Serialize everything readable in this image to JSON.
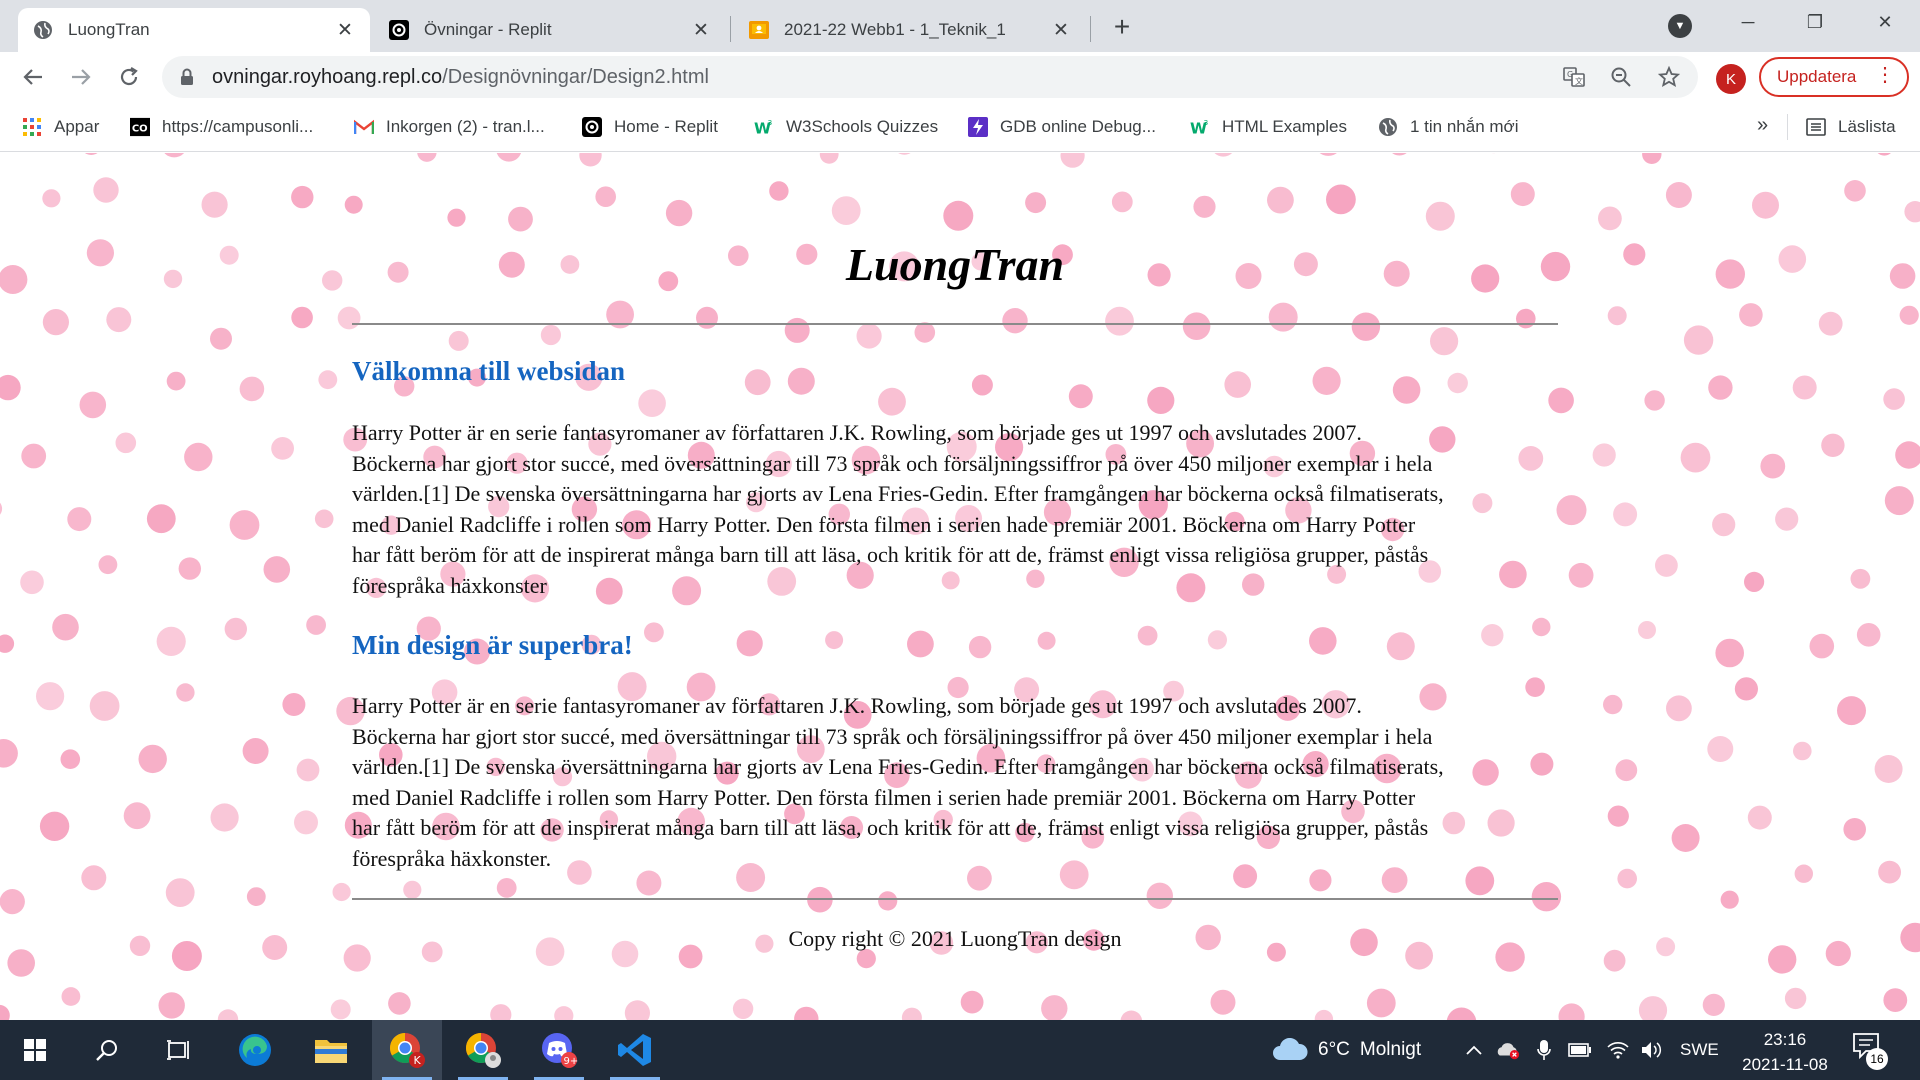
{
  "browser": {
    "tabs": [
      {
        "title": "LuongTran",
        "active": true,
        "icon": "globe-icon"
      },
      {
        "title": "Övningar - Replit",
        "active": false,
        "icon": "replit-icon"
      },
      {
        "title": "2021-22 Webb1 - 1_Teknik_1",
        "active": false,
        "icon": "classroom-icon"
      }
    ],
    "new_tab": "+",
    "window_controls": {
      "minimize": "─",
      "restore": "❐",
      "close": "✕"
    },
    "address": {
      "host": "ovningar.royhoang.repl.co",
      "path": "/Designövningar/Design2.html"
    },
    "profile_initial": "K",
    "update_label": "Uppdatera",
    "bookmarks": [
      {
        "label": "Appar",
        "icon": "apps-grid-icon"
      },
      {
        "label": "https://campusonli...",
        "icon": "campus-icon"
      },
      {
        "label": "Inkorgen (2) - tran.l...",
        "icon": "gmail-icon"
      },
      {
        "label": "Home - Replit",
        "icon": "replit-icon"
      },
      {
        "label": "W3Schools Quizzes",
        "icon": "w3schools-icon"
      },
      {
        "label": "GDB online Debug...",
        "icon": "gdb-icon"
      },
      {
        "label": "HTML Examples",
        "icon": "w3schools-icon"
      },
      {
        "label": "1 tin nhắn mới",
        "icon": "globe-icon"
      }
    ],
    "bookmarks_more": "»",
    "reading_list": "Läslista"
  },
  "page": {
    "site_title": "LuongTran",
    "sections": [
      {
        "heading": "Välkomna till websidan",
        "lines": [
          "Harry Potter är en serie fantasyromaner av författaren J.K. Rowling, som började ges ut 1997 och avslutades 2007.",
          "Böckerna har gjort stor succé, med översättningar till 73 språk och försäljningssiffror på över 450 miljoner exemplar i hela",
          "världen.[1] De svenska översättningarna har gjorts av Lena Fries-Gedin. Efter framgången har böckerna också filmatiserats,",
          "med Daniel Radcliffe i rollen som Harry Potter. Den första filmen i serien hade premiär 2001. Böckerna om Harry Potter",
          "har fått beröm för att de inspirerat många barn till att läsa, och kritik för att de, främst enligt vissa religiösa grupper, påstås",
          "förespråka häxkonster"
        ]
      },
      {
        "heading": "Min design är superbra!",
        "lines": [
          "Harry Potter är en serie fantasyromaner av författaren J.K. Rowling, som började ges ut 1997 och avslutades 2007.",
          "Böckerna har gjort stor succé, med översättningar till 73 språk och försäljningssiffror på över 450 miljoner exemplar i hela",
          "världen.[1] De svenska översättningarna har gjorts av Lena Fries-Gedin. Efter framgången har böckerna också filmatiserats,",
          "med Daniel Radcliffe i rollen som Harry Potter. Den första filmen i serien hade premiär 2001. Böckerna om Harry Potter",
          "har fått beröm för att de inspirerat många barn till att läsa, och kritik för att de, främst enligt vissa religiösa grupper, påstås",
          "förespråka häxkonster."
        ]
      }
    ],
    "footer": "Copy right © 2021 LuongTran design",
    "colors": {
      "heading": "#1565c0",
      "dots": "#f48fb1"
    }
  },
  "taskbar": {
    "weather": {
      "temp": "6°C",
      "condition": "Molnigt"
    },
    "language": "SWE",
    "time": "23:16",
    "date": "2021-11-08",
    "notifications": "16"
  }
}
